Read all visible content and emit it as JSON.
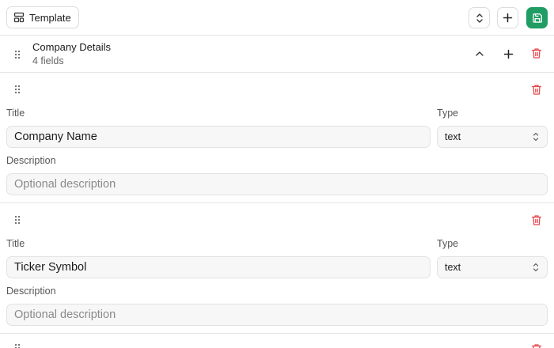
{
  "toolbar": {
    "template_label": "Template",
    "icons": [
      "layout-template-icon",
      "chevrons-up-down-icon",
      "plus-icon",
      "save-icon"
    ]
  },
  "section": {
    "title": "Company Details",
    "subtitle": "4 fields"
  },
  "labels": {
    "title": "Title",
    "type": "Type",
    "description": "Description"
  },
  "fields": [
    {
      "title": "Company Name",
      "type": "text",
      "description_placeholder": "Optional description"
    },
    {
      "title": "Ticker Symbol",
      "type": "text",
      "description_placeholder": "Optional description"
    }
  ],
  "colors": {
    "accent": "#1f9d63",
    "danger": "#e5484d",
    "border": "#e5e5e5"
  }
}
